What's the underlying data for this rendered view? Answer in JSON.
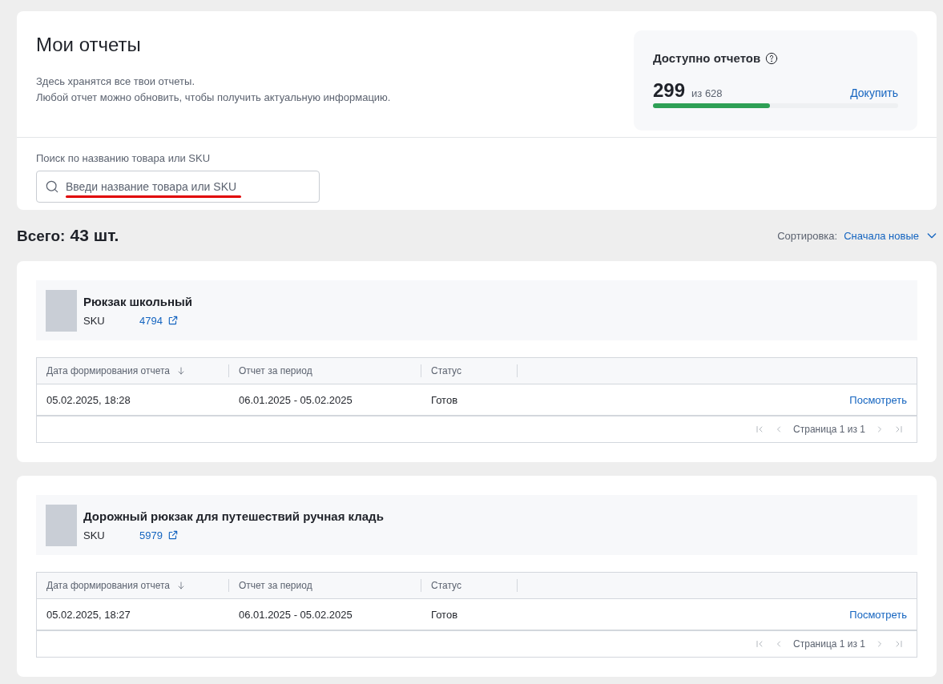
{
  "header": {
    "title": "Мои отчеты",
    "description": [
      "Здесь хранятся все твои отчеты.",
      "Любой отчет можно обновить, чтобы получить актуальную информацию."
    ]
  },
  "quota": {
    "label": "Доступно отчетов",
    "available": "299",
    "total": "из 628",
    "level": 0.476,
    "buy": "Докупить"
  },
  "search": {
    "label": "Поиск по названию товара или SKU",
    "placeholder": "Введи название товара или SKU",
    "underlined": true
  },
  "summary": {
    "label": "Всего:",
    "count": "43 шт.",
    "sort_label": "Сортировка:",
    "sort_value": "Сначала новые"
  },
  "reports": [
    {
      "product": "Рюкзак школьный",
      "sku_label": "SKU",
      "sku": "4794",
      "columns": [
        {
          "label": "Дата формирования отчета",
          "sorted": true
        },
        {
          "label": "Отчет за период",
          "sorted": false
        },
        {
          "label": "Статус",
          "sorted": false
        }
      ],
      "rows": [
        {
          "date": "05.02.2025, 18:28",
          "period": "06.01.2025 - 05.02.2025",
          "status": "Готов",
          "action": "Посмотреть"
        }
      ],
      "pagination": "Страница 1 из 1"
    },
    {
      "product": "Дорожный рюкзак для путешествий ручная кладь",
      "sku_label": "SKU",
      "sku": "5979",
      "columns": [
        {
          "label": "Дата формирования отчета",
          "sorted": true
        },
        {
          "label": "Отчет за период",
          "sorted": false
        },
        {
          "label": "Статус",
          "sorted": false
        }
      ],
      "rows": [
        {
          "date": "05.02.2025, 18:27",
          "period": "06.01.2025 - 05.02.2025",
          "status": "Готов",
          "action": "Посмотреть"
        }
      ],
      "pagination": "Страница 1 из 1"
    }
  ]
}
